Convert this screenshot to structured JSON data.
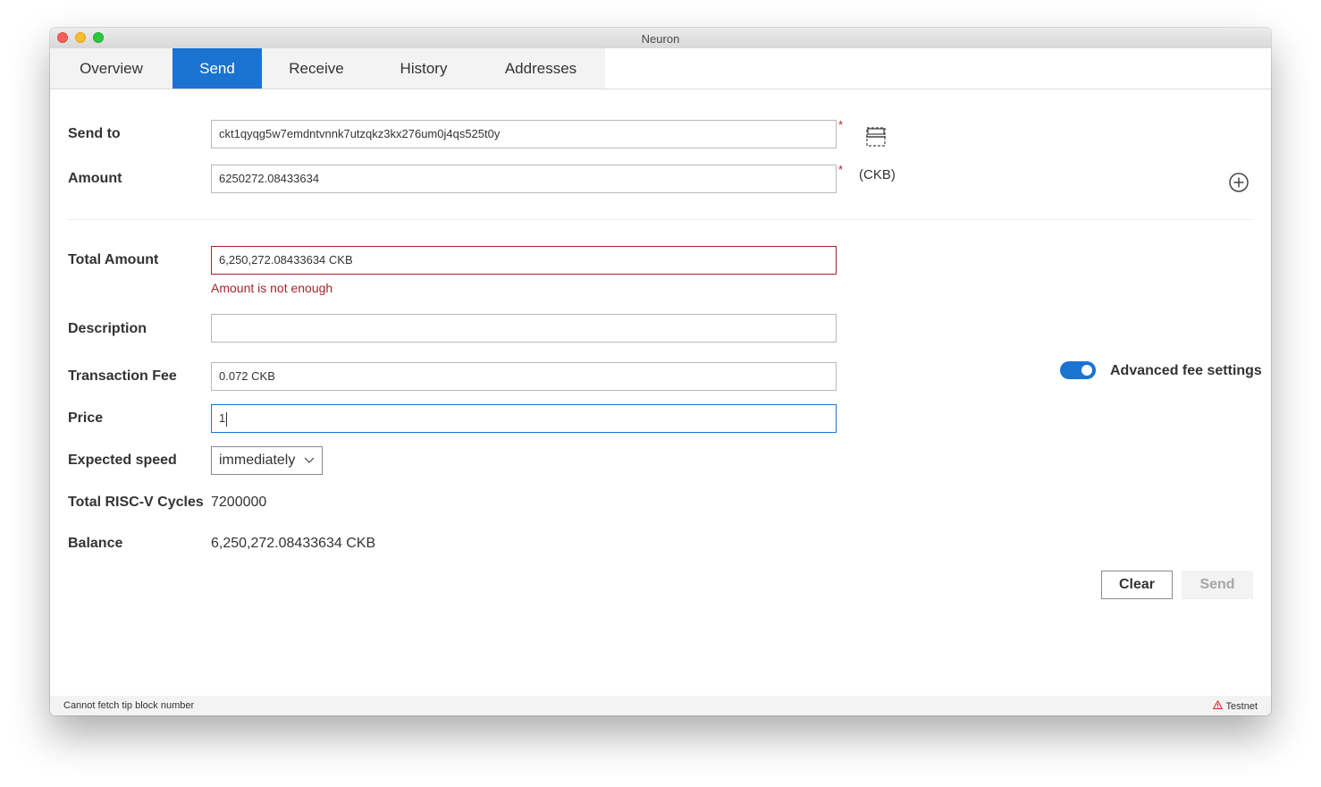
{
  "window": {
    "title": "Neuron"
  },
  "tabs": [
    {
      "label": "Overview",
      "active": false
    },
    {
      "label": "Send",
      "active": true
    },
    {
      "label": "Receive",
      "active": false
    },
    {
      "label": "History",
      "active": false
    },
    {
      "label": "Addresses",
      "active": false
    }
  ],
  "form": {
    "send_to": {
      "label": "Send to",
      "value": "ckt1qyqg5w7emdntvnnk7utzqkz3kx276um0j4qs525t0y",
      "required_mark": "*"
    },
    "amount": {
      "label": "Amount",
      "value": "6250272.08433634",
      "unit": "(CKB)",
      "required_mark": "*"
    },
    "total_amount": {
      "label": "Total Amount",
      "value": "6,250,272.08433634 CKB",
      "error": "Amount is not enough"
    },
    "description": {
      "label": "Description",
      "value": ""
    },
    "transaction_fee": {
      "label": "Transaction Fee",
      "value": "0.072 CKB"
    },
    "price": {
      "label": "Price",
      "value": "1"
    },
    "expected_speed": {
      "label": "Expected speed",
      "selected": "immediately"
    },
    "total_cycles": {
      "label": "Total RISC-V Cycles",
      "value": "7200000"
    },
    "balance": {
      "label": "Balance",
      "value": "6,250,272.08433634 CKB"
    }
  },
  "advanced_fee": {
    "label": "Advanced fee settings",
    "enabled": true
  },
  "buttons": {
    "clear": "Clear",
    "send": "Send"
  },
  "status": {
    "left": "Cannot fetch tip block number",
    "network": "Testnet"
  },
  "icons": {
    "scan": "qr-scan-icon",
    "add": "add-circle-icon",
    "dropdown": "chevron-down-icon",
    "warning": "warning-triangle-icon"
  },
  "colors": {
    "accent": "#1a73d1",
    "error": "#a4262c",
    "disabled_text": "#a6a6a6"
  }
}
